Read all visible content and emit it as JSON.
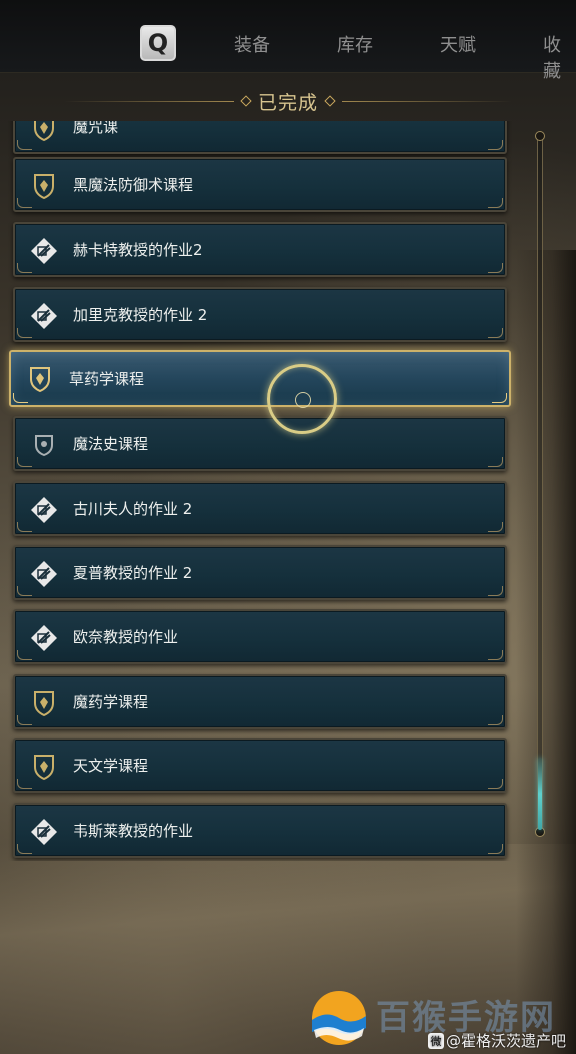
{
  "topbar": {
    "key_label": "Q",
    "tabs": [
      "装备",
      "库存",
      "天赋",
      "收藏"
    ]
  },
  "section": {
    "title": "已完成"
  },
  "items": [
    {
      "label": "魔咒课",
      "icon": "crest-icon"
    },
    {
      "label": "黑魔法防御术课程",
      "icon": "crest-icon"
    },
    {
      "label": "赫卡特教授的作业2",
      "icon": "quill-diamond-icon"
    },
    {
      "label": "加里克教授的作业 2",
      "icon": "quill-diamond-icon"
    },
    {
      "label": "草药学课程",
      "icon": "crest-icon",
      "selected": true
    },
    {
      "label": "魔法史课程",
      "icon": "shield-icon"
    },
    {
      "label": "古川夫人的作业 2",
      "icon": "quill-diamond-icon"
    },
    {
      "label": "夏普教授的作业 2",
      "icon": "quill-diamond-icon"
    },
    {
      "label": "欧奈教授的作业",
      "icon": "quill-diamond-icon"
    },
    {
      "label": "魔药学课程",
      "icon": "crest-icon"
    },
    {
      "label": "天文学课程",
      "icon": "crest-icon"
    },
    {
      "label": "韦斯莱教授的作业",
      "icon": "quill-diamond-icon"
    }
  ],
  "watermark": {
    "site_text": "百猴手游网",
    "weibo_icon": "微",
    "weibo_text": "@霍格沃茨遗产吧"
  }
}
